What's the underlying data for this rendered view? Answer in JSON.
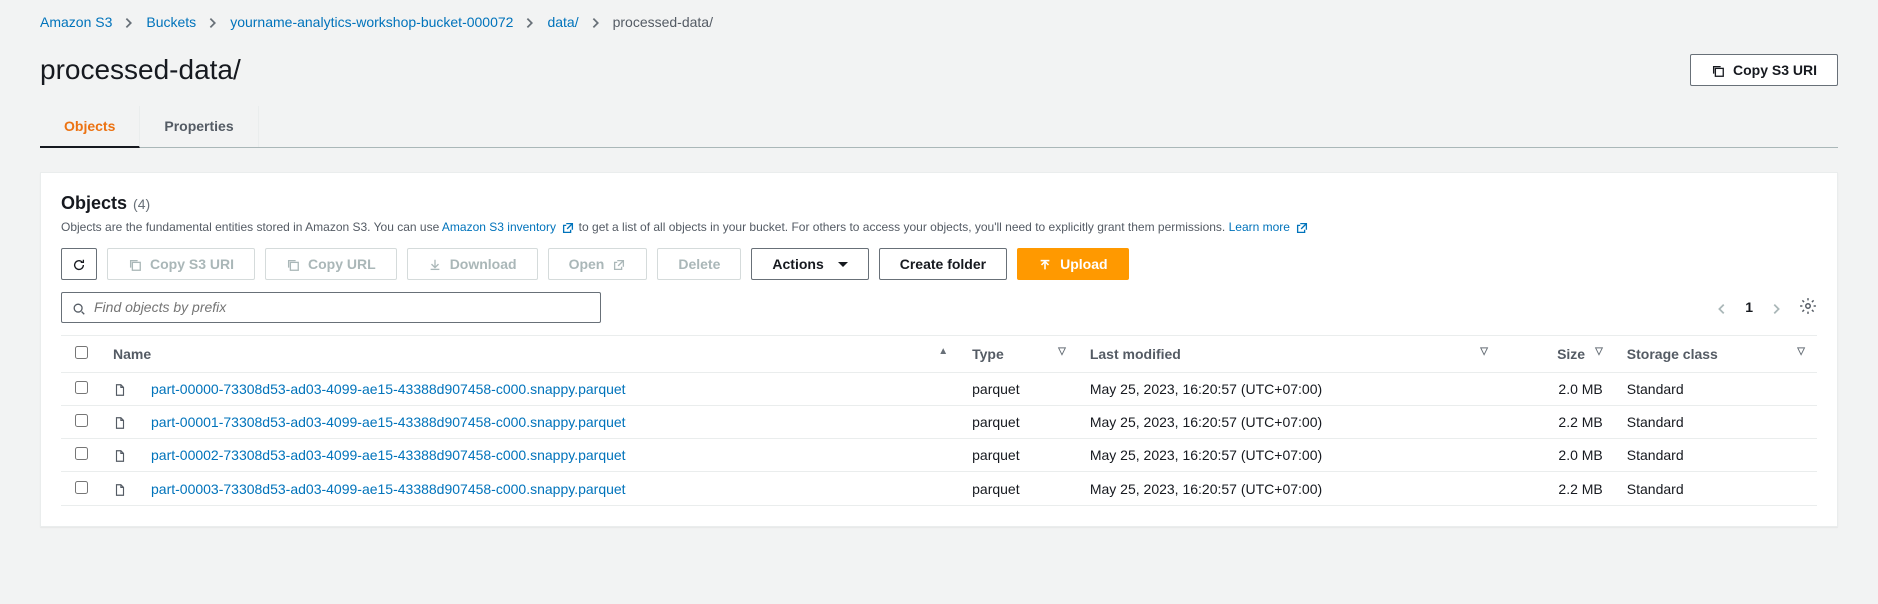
{
  "breadcrumb": {
    "items": [
      {
        "label": "Amazon S3"
      },
      {
        "label": "Buckets"
      },
      {
        "label": "yourname-analytics-workshop-bucket-000072"
      },
      {
        "label": "data/"
      }
    ],
    "current": "processed-data/"
  },
  "pageTitle": "processed-data/",
  "copyUriLabel": "Copy S3 URI",
  "tabs": {
    "objects": "Objects",
    "properties": "Properties"
  },
  "panel": {
    "title": "Objects",
    "count": "(4)",
    "descPrefix": "Objects are the fundamental entities stored in Amazon S3. You can use ",
    "inventoryLink": "Amazon S3 inventory",
    "descMiddle": " to get a list of all objects in your bucket. For others to access your objects, you'll need to explicitly grant them permissions. ",
    "learnMore": "Learn more"
  },
  "toolbar": {
    "copyS3Uri": "Copy S3 URI",
    "copyUrl": "Copy URL",
    "download": "Download",
    "open": "Open",
    "delete": "Delete",
    "actions": "Actions",
    "createFolder": "Create folder",
    "upload": "Upload"
  },
  "search": {
    "placeholder": "Find objects by prefix"
  },
  "pagination": {
    "page": "1"
  },
  "columns": {
    "name": "Name",
    "type": "Type",
    "lastModified": "Last modified",
    "size": "Size",
    "storageClass": "Storage class"
  },
  "rows": [
    {
      "name": "part-00000-73308d53-ad03-4099-ae15-43388d907458-c000.snappy.parquet",
      "type": "parquet",
      "lastModified": "May 25, 2023, 16:20:57 (UTC+07:00)",
      "size": "2.0 MB",
      "storageClass": "Standard"
    },
    {
      "name": "part-00001-73308d53-ad03-4099-ae15-43388d907458-c000.snappy.parquet",
      "type": "parquet",
      "lastModified": "May 25, 2023, 16:20:57 (UTC+07:00)",
      "size": "2.2 MB",
      "storageClass": "Standard"
    },
    {
      "name": "part-00002-73308d53-ad03-4099-ae15-43388d907458-c000.snappy.parquet",
      "type": "parquet",
      "lastModified": "May 25, 2023, 16:20:57 (UTC+07:00)",
      "size": "2.0 MB",
      "storageClass": "Standard"
    },
    {
      "name": "part-00003-73308d53-ad03-4099-ae15-43388d907458-c000.snappy.parquet",
      "type": "parquet",
      "lastModified": "May 25, 2023, 16:20:57 (UTC+07:00)",
      "size": "2.2 MB",
      "storageClass": "Standard"
    }
  ]
}
